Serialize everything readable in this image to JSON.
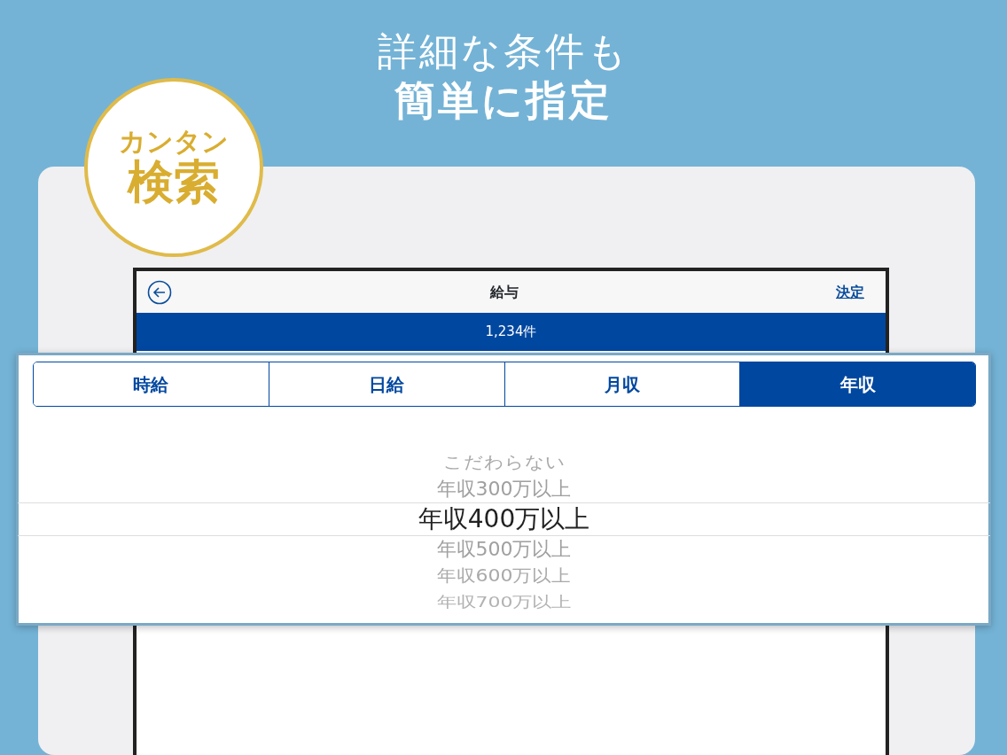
{
  "headline": {
    "line_1": "詳細な条件も",
    "line_2": "簡単に指定"
  },
  "badge": {
    "line_1": "カンタン",
    "line_2": "検索"
  },
  "nav_bar": {
    "title": "給与",
    "action": "決定"
  },
  "result_count": "1,234件",
  "tabs": [
    {
      "label": "時給",
      "selected": false
    },
    {
      "label": "日給",
      "selected": false
    },
    {
      "label": "月収",
      "selected": false
    },
    {
      "label": "年収",
      "selected": true
    }
  ],
  "picker": {
    "options": [
      {
        "label": "こだわらない",
        "selected": false
      },
      {
        "label": "年収300万以上",
        "selected": false
      },
      {
        "label": "年収400万以上",
        "selected": true
      },
      {
        "label": "年収500万以上",
        "selected": false
      },
      {
        "label": "年収600万以上",
        "selected": false
      },
      {
        "label": "年収700万以上",
        "selected": false
      }
    ]
  }
}
